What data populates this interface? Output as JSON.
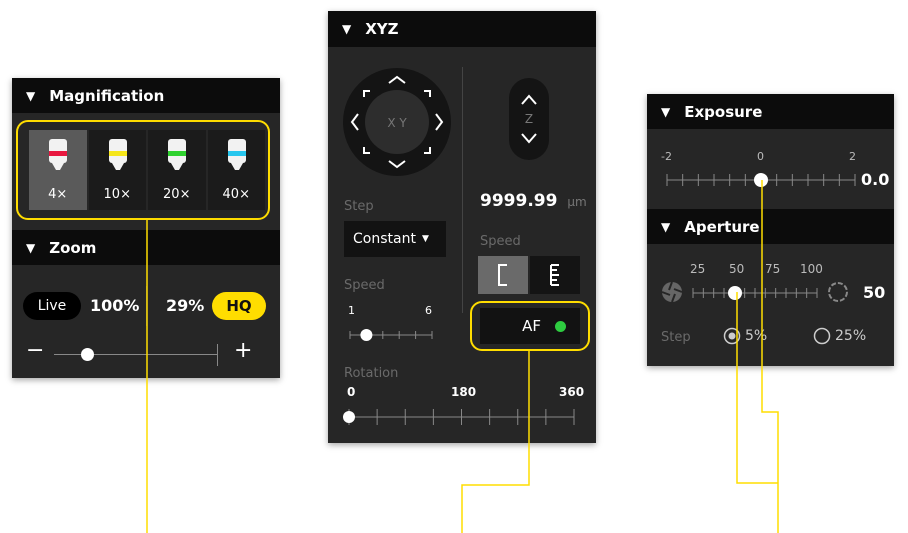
{
  "magnification": {
    "title": "Magnification",
    "lenses": [
      {
        "label": "4×",
        "color": "#e8173f",
        "selected": true
      },
      {
        "label": "10×",
        "color": "#f5e61b",
        "selected": false
      },
      {
        "label": "20×",
        "color": "#2fd22f",
        "selected": false
      },
      {
        "label": "40×",
        "color": "#27c6ee",
        "selected": false
      }
    ]
  },
  "zoom": {
    "title": "Zoom",
    "live_label": "Live",
    "live_percent": "100%",
    "hq_percent": "29%",
    "hq_label": "HQ",
    "minus": "−",
    "plus": "+",
    "slider_value": 0.2
  },
  "xyz": {
    "title": "XYZ",
    "xy_label": "X Y",
    "z_label": "Z",
    "position": "9999.99",
    "unit": "μm",
    "step_label": "Step",
    "step_value": "Constant",
    "speed_label_left": "Speed",
    "speed_min": "1",
    "speed_max": "6",
    "speed_value": 2,
    "speed_label_right": "Speed",
    "af_label": "AF",
    "af_status_color": "#2ecc40",
    "rotation_label": "Rotation",
    "rotation_ticks": [
      "0",
      "180",
      "360"
    ],
    "rotation_value": 0
  },
  "exposure": {
    "title": "Exposure",
    "ticks": [
      "-2",
      "0",
      "2"
    ],
    "value": "0.0"
  },
  "aperture": {
    "title": "Aperture",
    "ticks": [
      "25",
      "50",
      "75",
      "100"
    ],
    "value": "50",
    "step_label": "Step",
    "options": [
      {
        "label": "5%",
        "selected": true
      },
      {
        "label": "25%",
        "selected": false
      }
    ]
  },
  "accent_color": "#ffdd00"
}
